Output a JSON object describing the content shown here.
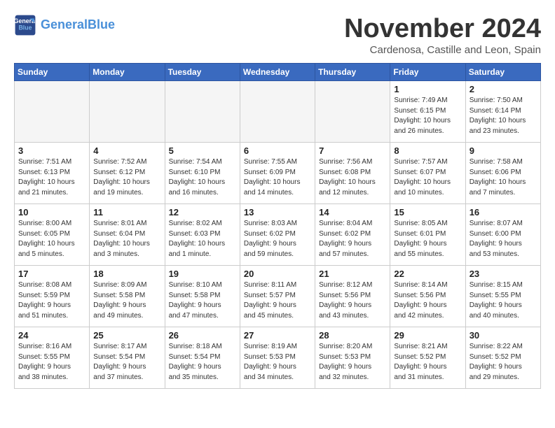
{
  "header": {
    "logo_line1": "General",
    "logo_line2": "Blue",
    "month": "November 2024",
    "location": "Cardenosa, Castille and Leon, Spain"
  },
  "days_of_week": [
    "Sunday",
    "Monday",
    "Tuesday",
    "Wednesday",
    "Thursday",
    "Friday",
    "Saturday"
  ],
  "weeks": [
    [
      {
        "day": "",
        "info": ""
      },
      {
        "day": "",
        "info": ""
      },
      {
        "day": "",
        "info": ""
      },
      {
        "day": "",
        "info": ""
      },
      {
        "day": "",
        "info": ""
      },
      {
        "day": "1",
        "info": "Sunrise: 7:49 AM\nSunset: 6:15 PM\nDaylight: 10 hours\nand 26 minutes."
      },
      {
        "day": "2",
        "info": "Sunrise: 7:50 AM\nSunset: 6:14 PM\nDaylight: 10 hours\nand 23 minutes."
      }
    ],
    [
      {
        "day": "3",
        "info": "Sunrise: 7:51 AM\nSunset: 6:13 PM\nDaylight: 10 hours\nand 21 minutes."
      },
      {
        "day": "4",
        "info": "Sunrise: 7:52 AM\nSunset: 6:12 PM\nDaylight: 10 hours\nand 19 minutes."
      },
      {
        "day": "5",
        "info": "Sunrise: 7:54 AM\nSunset: 6:10 PM\nDaylight: 10 hours\nand 16 minutes."
      },
      {
        "day": "6",
        "info": "Sunrise: 7:55 AM\nSunset: 6:09 PM\nDaylight: 10 hours\nand 14 minutes."
      },
      {
        "day": "7",
        "info": "Sunrise: 7:56 AM\nSunset: 6:08 PM\nDaylight: 10 hours\nand 12 minutes."
      },
      {
        "day": "8",
        "info": "Sunrise: 7:57 AM\nSunset: 6:07 PM\nDaylight: 10 hours\nand 10 minutes."
      },
      {
        "day": "9",
        "info": "Sunrise: 7:58 AM\nSunset: 6:06 PM\nDaylight: 10 hours\nand 7 minutes."
      }
    ],
    [
      {
        "day": "10",
        "info": "Sunrise: 8:00 AM\nSunset: 6:05 PM\nDaylight: 10 hours\nand 5 minutes."
      },
      {
        "day": "11",
        "info": "Sunrise: 8:01 AM\nSunset: 6:04 PM\nDaylight: 10 hours\nand 3 minutes."
      },
      {
        "day": "12",
        "info": "Sunrise: 8:02 AM\nSunset: 6:03 PM\nDaylight: 10 hours\nand 1 minute."
      },
      {
        "day": "13",
        "info": "Sunrise: 8:03 AM\nSunset: 6:02 PM\nDaylight: 9 hours\nand 59 minutes."
      },
      {
        "day": "14",
        "info": "Sunrise: 8:04 AM\nSunset: 6:02 PM\nDaylight: 9 hours\nand 57 minutes."
      },
      {
        "day": "15",
        "info": "Sunrise: 8:05 AM\nSunset: 6:01 PM\nDaylight: 9 hours\nand 55 minutes."
      },
      {
        "day": "16",
        "info": "Sunrise: 8:07 AM\nSunset: 6:00 PM\nDaylight: 9 hours\nand 53 minutes."
      }
    ],
    [
      {
        "day": "17",
        "info": "Sunrise: 8:08 AM\nSunset: 5:59 PM\nDaylight: 9 hours\nand 51 minutes."
      },
      {
        "day": "18",
        "info": "Sunrise: 8:09 AM\nSunset: 5:58 PM\nDaylight: 9 hours\nand 49 minutes."
      },
      {
        "day": "19",
        "info": "Sunrise: 8:10 AM\nSunset: 5:58 PM\nDaylight: 9 hours\nand 47 minutes."
      },
      {
        "day": "20",
        "info": "Sunrise: 8:11 AM\nSunset: 5:57 PM\nDaylight: 9 hours\nand 45 minutes."
      },
      {
        "day": "21",
        "info": "Sunrise: 8:12 AM\nSunset: 5:56 PM\nDaylight: 9 hours\nand 43 minutes."
      },
      {
        "day": "22",
        "info": "Sunrise: 8:14 AM\nSunset: 5:56 PM\nDaylight: 9 hours\nand 42 minutes."
      },
      {
        "day": "23",
        "info": "Sunrise: 8:15 AM\nSunset: 5:55 PM\nDaylight: 9 hours\nand 40 minutes."
      }
    ],
    [
      {
        "day": "24",
        "info": "Sunrise: 8:16 AM\nSunset: 5:55 PM\nDaylight: 9 hours\nand 38 minutes."
      },
      {
        "day": "25",
        "info": "Sunrise: 8:17 AM\nSunset: 5:54 PM\nDaylight: 9 hours\nand 37 minutes."
      },
      {
        "day": "26",
        "info": "Sunrise: 8:18 AM\nSunset: 5:54 PM\nDaylight: 9 hours\nand 35 minutes."
      },
      {
        "day": "27",
        "info": "Sunrise: 8:19 AM\nSunset: 5:53 PM\nDaylight: 9 hours\nand 34 minutes."
      },
      {
        "day": "28",
        "info": "Sunrise: 8:20 AM\nSunset: 5:53 PM\nDaylight: 9 hours\nand 32 minutes."
      },
      {
        "day": "29",
        "info": "Sunrise: 8:21 AM\nSunset: 5:52 PM\nDaylight: 9 hours\nand 31 minutes."
      },
      {
        "day": "30",
        "info": "Sunrise: 8:22 AM\nSunset: 5:52 PM\nDaylight: 9 hours\nand 29 minutes."
      }
    ]
  ]
}
